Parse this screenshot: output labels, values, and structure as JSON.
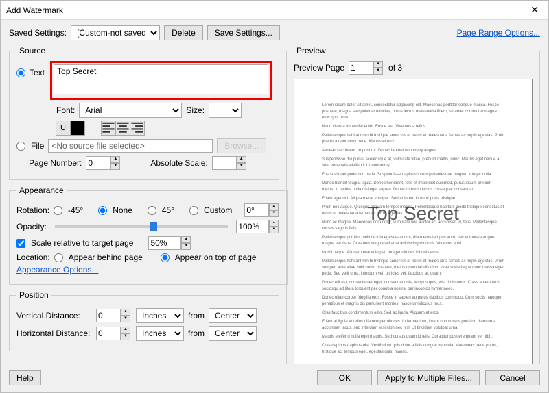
{
  "title": "Add Watermark",
  "savedSettings": {
    "label": "Saved Settings:",
    "value": "[Custom-not saved]",
    "deleteLabel": "Delete",
    "saveLabel": "Save Settings..."
  },
  "pageRangeLink": "Page Range Options...",
  "source": {
    "legend": "Source",
    "textLabel": "Text",
    "textValue": "Top Secret",
    "fontLabel": "Font:",
    "fontValue": "Arial",
    "sizeLabel": "Size:",
    "sizeValue": "",
    "fileLabel": "File",
    "fileValue": "<No source file selected>",
    "browseLabel": "Browse...",
    "pageNumLabel": "Page Number:",
    "pageNumValue": "0",
    "absScaleLabel": "Absolute Scale:",
    "absScaleValue": ""
  },
  "appearance": {
    "legend": "Appearance",
    "rotationLabel": "Rotation:",
    "rotOptions": {
      "neg45": "-45°",
      "none": "None",
      "pos45": "45°",
      "custom": "Custom"
    },
    "customDeg": "0°",
    "opacityLabel": "Opacity:",
    "opacityValue": "100%",
    "scaleRelLabel": "Scale relative to target page",
    "scaleRelValue": "50%",
    "locationLabel": "Location:",
    "behind": "Appear behind page",
    "ontop": "Appear on top of page",
    "optionsLink": "Appearance Options..."
  },
  "position": {
    "legend": "Position",
    "vdistLabel": "Vertical Distance:",
    "vdistValue": "0",
    "hdistLabel": "Horizontal Distance:",
    "hdistValue": "0",
    "unit": "Inches",
    "fromLabel": "from",
    "fromValue": "Center"
  },
  "preview": {
    "legend": "Preview",
    "pageLabel": "Preview Page",
    "pageValue": "1",
    "pageTotal": "of 3",
    "watermark": "Top Secret"
  },
  "footer": {
    "help": "Help",
    "ok": "OK",
    "multi": "Apply to Multiple Files...",
    "cancel": "Cancel"
  }
}
